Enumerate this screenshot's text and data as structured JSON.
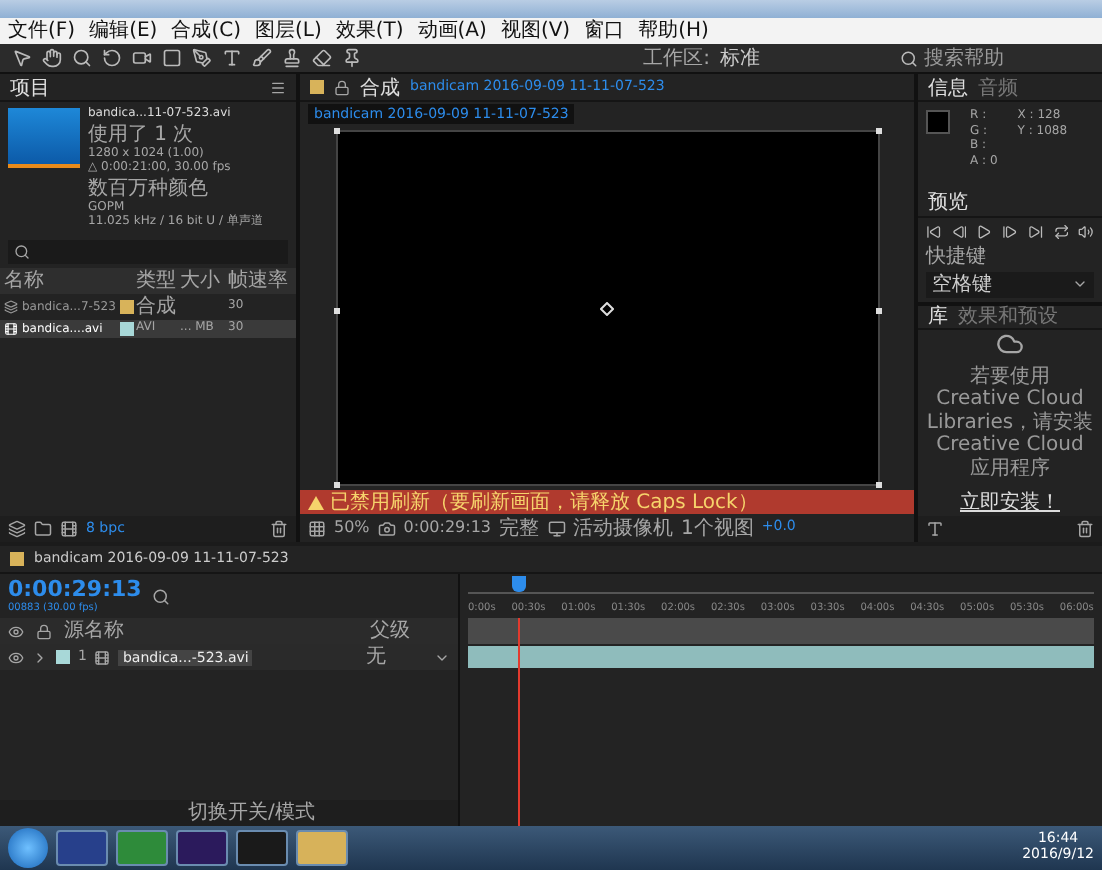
{
  "menu": [
    "文件(F)",
    "编辑(E)",
    "合成(C)",
    "图层(L)",
    "效果(T)",
    "动画(A)",
    "视图(V)",
    "窗口",
    "帮助(H)"
  ],
  "toolbar": {
    "workspace_label": "工作区:",
    "workspace": "标准",
    "search_placeholder": "搜索帮助"
  },
  "project": {
    "tab": "项目",
    "item_name": "bandica...11-07-523.avi",
    "used": "使用了 1 次",
    "info": [
      "1280 x 1024 (1.00)",
      "△ 0:00:21:00, 30.00 fps",
      "数百万种颜色",
      "GOPM",
      "11.025 kHz / 16 bit U / 单声道"
    ],
    "columns": [
      "名称",
      "类型",
      "大小",
      "帧速率"
    ],
    "rows": [
      {
        "kind": "comp",
        "name": "bandica...7-523",
        "color": "#d8b35a",
        "type": "合成",
        "size": "",
        "fps": "30",
        "selected": false
      },
      {
        "kind": "footage",
        "name": "bandica....avi",
        "color": "#a8d8d8",
        "type": "AVI",
        "size": "... MB",
        "fps": "30",
        "selected": true
      }
    ],
    "bpc": "8 bpc"
  },
  "composition": {
    "tab": "合成",
    "name": "bandicam 2016-09-09 11-11-07-523",
    "breadcrumb": "bandicam 2016-09-09 11-11-07-523",
    "warning": "已禁用刷新（要刷新画面，请释放 Caps Lock）",
    "zoom": "50%",
    "timecode": "0:00:29:13",
    "resolution": "完整",
    "camera": "活动摄像机",
    "views": "1个视图",
    "exposure": "+0.0"
  },
  "info": {
    "tabs": [
      {
        "label": "信息",
        "selected": true
      },
      {
        "label": "音频",
        "selected": false
      }
    ],
    "rgba": [
      "R :",
      "G :",
      "B :",
      "A : 0"
    ],
    "xy": [
      "X : 128",
      "Y : 1088"
    ]
  },
  "preview": {
    "tab": "预览",
    "shortcut_label": "快捷键",
    "shortcut": "空格键"
  },
  "libraries": {
    "tabs": [
      {
        "label": "库",
        "selected": true
      },
      {
        "label": "效果和预设",
        "selected": false
      }
    ],
    "message": "若要使用 Creative Cloud Libraries，请安装 Creative Cloud 应用程序",
    "link": "立即安装！"
  },
  "timeline": {
    "tab": "bandicam 2016-09-09 11-11-07-523",
    "timecode": "0:00:29:13",
    "frames": "00883 (30.00 fps)",
    "columns": [
      "源名称",
      "父级"
    ],
    "ticks": [
      "0:00s",
      "00:30s",
      "01:00s",
      "01:30s",
      "02:00s",
      "02:30s",
      "03:00s",
      "03:30s",
      "04:00s",
      "04:30s",
      "05:00s",
      "05:30s",
      "06:00s"
    ],
    "layer": {
      "index": "1",
      "name": "bandica...-523.avi",
      "parent": "无"
    },
    "playhead": {
      "level": 0.08
    },
    "footer": "切换开关/模式"
  },
  "taskbar": {
    "clock": "16:44",
    "date": "2016/9/12"
  }
}
